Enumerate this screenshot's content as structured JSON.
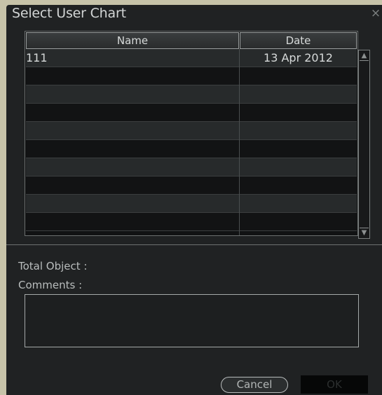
{
  "dialog": {
    "title": "Select User Chart",
    "close_symbol": "×"
  },
  "table": {
    "columns": [
      "Name",
      "Date"
    ],
    "rows": [
      {
        "name": "111",
        "date": "13 Apr 2012"
      },
      {
        "name": "",
        "date": ""
      },
      {
        "name": "",
        "date": ""
      },
      {
        "name": "",
        "date": ""
      },
      {
        "name": "",
        "date": ""
      },
      {
        "name": "",
        "date": ""
      },
      {
        "name": "",
        "date": ""
      },
      {
        "name": "",
        "date": ""
      },
      {
        "name": "",
        "date": ""
      },
      {
        "name": "",
        "date": ""
      }
    ]
  },
  "scrollbar": {
    "up_icon": "scroll-up-arrow-icon",
    "down_icon": "scroll-down-arrow-icon"
  },
  "details": {
    "total_object_label": "Total Object :",
    "comments_label": "Comments :",
    "comments_value": ""
  },
  "buttons": {
    "cancel": "Cancel",
    "ok": "OK"
  }
}
